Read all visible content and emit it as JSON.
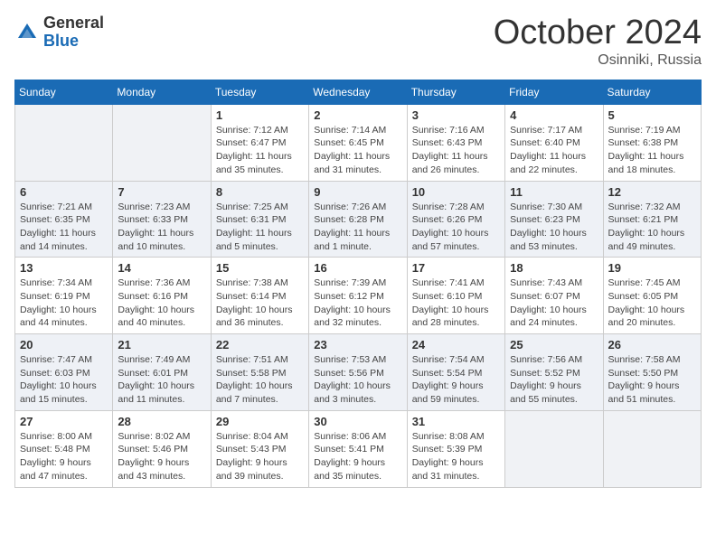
{
  "logo": {
    "general": "General",
    "blue": "Blue"
  },
  "title": "October 2024",
  "location": "Osinniki, Russia",
  "days_header": [
    "Sunday",
    "Monday",
    "Tuesday",
    "Wednesday",
    "Thursday",
    "Friday",
    "Saturday"
  ],
  "weeks": [
    [
      {
        "day": "",
        "info": ""
      },
      {
        "day": "",
        "info": ""
      },
      {
        "day": "1",
        "info": "Sunrise: 7:12 AM\nSunset: 6:47 PM\nDaylight: 11 hours\nand 35 minutes."
      },
      {
        "day": "2",
        "info": "Sunrise: 7:14 AM\nSunset: 6:45 PM\nDaylight: 11 hours\nand 31 minutes."
      },
      {
        "day": "3",
        "info": "Sunrise: 7:16 AM\nSunset: 6:43 PM\nDaylight: 11 hours\nand 26 minutes."
      },
      {
        "day": "4",
        "info": "Sunrise: 7:17 AM\nSunset: 6:40 PM\nDaylight: 11 hours\nand 22 minutes."
      },
      {
        "day": "5",
        "info": "Sunrise: 7:19 AM\nSunset: 6:38 PM\nDaylight: 11 hours\nand 18 minutes."
      }
    ],
    [
      {
        "day": "6",
        "info": "Sunrise: 7:21 AM\nSunset: 6:35 PM\nDaylight: 11 hours\nand 14 minutes."
      },
      {
        "day": "7",
        "info": "Sunrise: 7:23 AM\nSunset: 6:33 PM\nDaylight: 11 hours\nand 10 minutes."
      },
      {
        "day": "8",
        "info": "Sunrise: 7:25 AM\nSunset: 6:31 PM\nDaylight: 11 hours\nand 5 minutes."
      },
      {
        "day": "9",
        "info": "Sunrise: 7:26 AM\nSunset: 6:28 PM\nDaylight: 11 hours\nand 1 minute."
      },
      {
        "day": "10",
        "info": "Sunrise: 7:28 AM\nSunset: 6:26 PM\nDaylight: 10 hours\nand 57 minutes."
      },
      {
        "day": "11",
        "info": "Sunrise: 7:30 AM\nSunset: 6:23 PM\nDaylight: 10 hours\nand 53 minutes."
      },
      {
        "day": "12",
        "info": "Sunrise: 7:32 AM\nSunset: 6:21 PM\nDaylight: 10 hours\nand 49 minutes."
      }
    ],
    [
      {
        "day": "13",
        "info": "Sunrise: 7:34 AM\nSunset: 6:19 PM\nDaylight: 10 hours\nand 44 minutes."
      },
      {
        "day": "14",
        "info": "Sunrise: 7:36 AM\nSunset: 6:16 PM\nDaylight: 10 hours\nand 40 minutes."
      },
      {
        "day": "15",
        "info": "Sunrise: 7:38 AM\nSunset: 6:14 PM\nDaylight: 10 hours\nand 36 minutes."
      },
      {
        "day": "16",
        "info": "Sunrise: 7:39 AM\nSunset: 6:12 PM\nDaylight: 10 hours\nand 32 minutes."
      },
      {
        "day": "17",
        "info": "Sunrise: 7:41 AM\nSunset: 6:10 PM\nDaylight: 10 hours\nand 28 minutes."
      },
      {
        "day": "18",
        "info": "Sunrise: 7:43 AM\nSunset: 6:07 PM\nDaylight: 10 hours\nand 24 minutes."
      },
      {
        "day": "19",
        "info": "Sunrise: 7:45 AM\nSunset: 6:05 PM\nDaylight: 10 hours\nand 20 minutes."
      }
    ],
    [
      {
        "day": "20",
        "info": "Sunrise: 7:47 AM\nSunset: 6:03 PM\nDaylight: 10 hours\nand 15 minutes."
      },
      {
        "day": "21",
        "info": "Sunrise: 7:49 AM\nSunset: 6:01 PM\nDaylight: 10 hours\nand 11 minutes."
      },
      {
        "day": "22",
        "info": "Sunrise: 7:51 AM\nSunset: 5:58 PM\nDaylight: 10 hours\nand 7 minutes."
      },
      {
        "day": "23",
        "info": "Sunrise: 7:53 AM\nSunset: 5:56 PM\nDaylight: 10 hours\nand 3 minutes."
      },
      {
        "day": "24",
        "info": "Sunrise: 7:54 AM\nSunset: 5:54 PM\nDaylight: 9 hours\nand 59 minutes."
      },
      {
        "day": "25",
        "info": "Sunrise: 7:56 AM\nSunset: 5:52 PM\nDaylight: 9 hours\nand 55 minutes."
      },
      {
        "day": "26",
        "info": "Sunrise: 7:58 AM\nSunset: 5:50 PM\nDaylight: 9 hours\nand 51 minutes."
      }
    ],
    [
      {
        "day": "27",
        "info": "Sunrise: 8:00 AM\nSunset: 5:48 PM\nDaylight: 9 hours\nand 47 minutes."
      },
      {
        "day": "28",
        "info": "Sunrise: 8:02 AM\nSunset: 5:46 PM\nDaylight: 9 hours\nand 43 minutes."
      },
      {
        "day": "29",
        "info": "Sunrise: 8:04 AM\nSunset: 5:43 PM\nDaylight: 9 hours\nand 39 minutes."
      },
      {
        "day": "30",
        "info": "Sunrise: 8:06 AM\nSunset: 5:41 PM\nDaylight: 9 hours\nand 35 minutes."
      },
      {
        "day": "31",
        "info": "Sunrise: 8:08 AM\nSunset: 5:39 PM\nDaylight: 9 hours\nand 31 minutes."
      },
      {
        "day": "",
        "info": ""
      },
      {
        "day": "",
        "info": ""
      }
    ]
  ]
}
